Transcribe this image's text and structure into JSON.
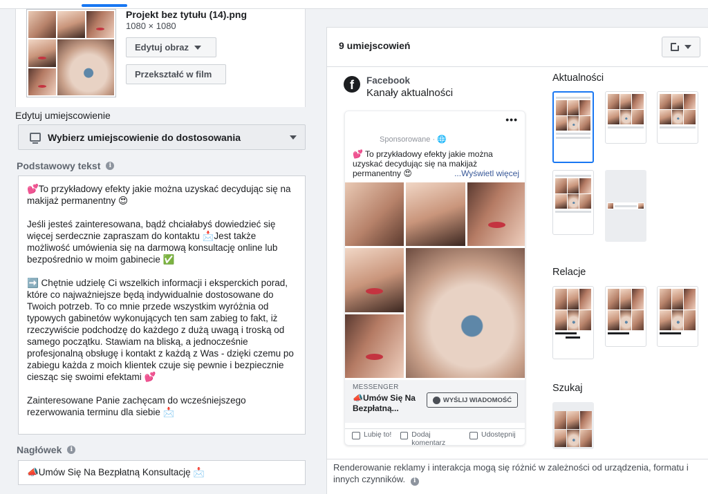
{
  "file": {
    "name": "Projekt bez tytułu (14).png",
    "size": "1080 × 1080",
    "edit_image_label": "Edytuj obraz",
    "to_film_label": "Przekształć w film"
  },
  "placement": {
    "label": "Edytuj umiejscowienie",
    "select_label": "Wybierz umiejscowienie do dostosowania"
  },
  "primary_text": {
    "label": "Podstawowy tekst",
    "value": "💕To przykładowy efekty jakie można uzyskać decydując się na makijaż permanentny 😍\n\nJeśli jesteś zainteresowana, bądź chciałabyś dowiedzieć się więcej serdecznie zapraszam do kontaktu 📩Jest także możliwość umówienia się na darmową konsultację online lub bezpośrednio w moim gabinecie ✅\n\n➡️ Chętnie udzielę Ci wszelkich informacji i eksperckich porad, które co najważniejsze będą indywidualnie dostosowane do Twoich potrzeb. To co mnie przede wszystkim wyróżnia od typowych gabinetów wykonujących ten sam zabieg to fakt, iż rzeczywiście podchodzę do każdego z dużą uwagą i troską od samego początku. Stawiam na bliską, a jednocześnie profesjonalną obsługę i kontakt z każdą z Was - dzięki czemu po zabiegu każda z moich klientek czuje się pewnie i bezpiecznie ciesząc się swoimi efektami 💕\n\nZainteresowane Panie zachęcam do wcześniejszego rezerwowania terminu dla siebie 📩"
  },
  "headline": {
    "label": "Nagłówek",
    "value": "📣Umów Się Na Bezpłatną Konsultację 📩"
  },
  "preview": {
    "title": "9 umiejscowień",
    "platform": "Facebook",
    "placement_name": "Kanały aktualności",
    "sponsored": "Sponsorowane · 🌐",
    "post_text": "💕 To przykładowy efekty jakie można uzyskać decydując się na makijaż permanentny 😍",
    "see_more": "...Wyświetl więcej",
    "cta_kicker": "MESSENGER",
    "cta_headline": "📣Umów Się Na Bezpłatną...",
    "cta_button": "WYŚLIJ WIADOMOŚĆ",
    "actions": [
      "Lubię to!",
      "Dodaj komentarz",
      "Udostępnij"
    ],
    "groups": [
      "Aktualności",
      "Relacje",
      "Szukaj"
    ],
    "footer": "Renderowanie reklamy i interakcja mogą się różnić w zależności od urządzenia, formatu i innych czynników."
  },
  "colors": {
    "accent": "#1877f2",
    "panel_bg": "#f0f2f5",
    "link": "#385898"
  }
}
